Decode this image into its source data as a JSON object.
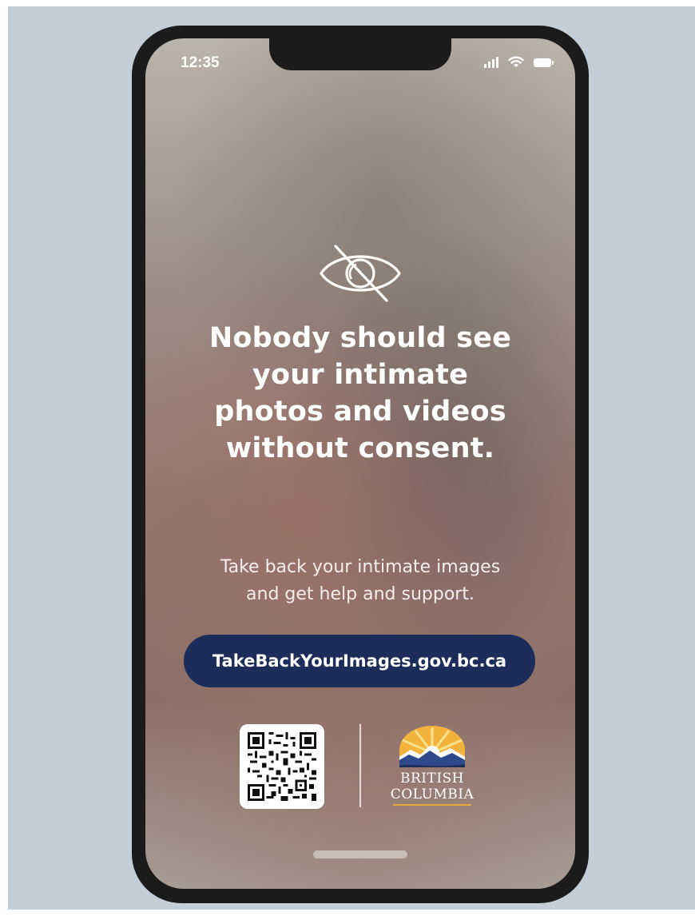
{
  "status_bar": {
    "time": "12:35",
    "icons": [
      "signal-icon",
      "wifi-icon",
      "battery-icon"
    ]
  },
  "content": {
    "icon": "eye-slash-icon",
    "headline_lines": [
      "Nobody should see",
      "your intimate",
      "photos and videos",
      "without consent."
    ],
    "subtext_lines": [
      "Take back your intimate images",
      "and get help and support."
    ],
    "cta_label": "TakeBackYourImages.gov.bc.ca"
  },
  "footer": {
    "qr_code": "qr-code",
    "logo": {
      "line1": "BRITISH",
      "line2": "COLUMBIA"
    }
  },
  "colors": {
    "backdrop": "#c5cdd9",
    "cta_background": "#1c2d5a",
    "phone_frame": "#1b1b1b",
    "logo_sun": "#f2b33d",
    "logo_mountains": "#2e4a8a"
  }
}
